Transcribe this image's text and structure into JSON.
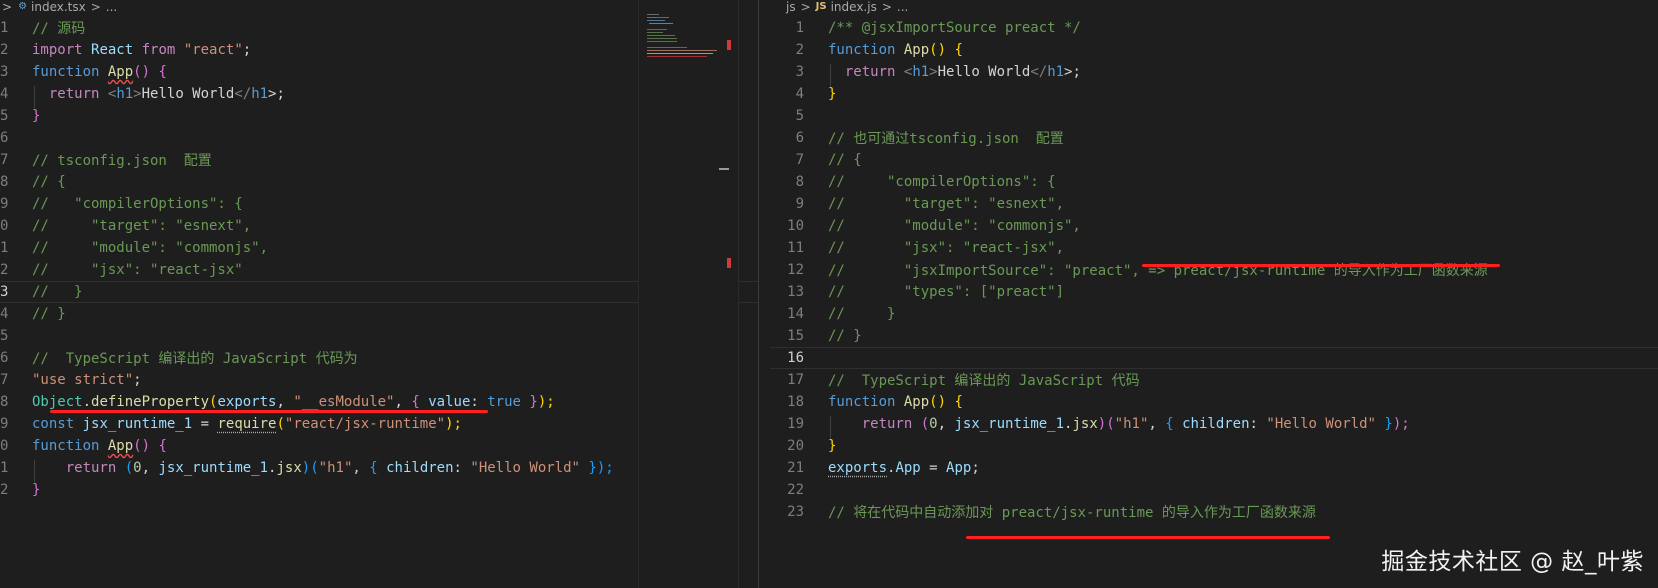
{
  "left_editor": {
    "breadcrumb": {
      "prefix": ">",
      "filename": "index.tsx",
      "sep": ">",
      "ellipsis": "..."
    },
    "lines": [
      "1",
      "2",
      "3",
      "4",
      "5",
      "6",
      "7",
      "8",
      "9",
      "0",
      "1",
      "2",
      "3",
      "4",
      "5",
      "6",
      "7",
      "8",
      "9",
      "0",
      "1",
      "2"
    ],
    "current_line_index": 12
  },
  "right_editor": {
    "breadcrumb": {
      "folder": "js",
      "sep": ">",
      "icon": "JS",
      "filename": "index.js",
      "sep2": ">",
      "ellipsis": "..."
    },
    "lines": [
      "1",
      "2",
      "3",
      "4",
      "5",
      "6",
      "7",
      "8",
      "9",
      "10",
      "11",
      "12",
      "13",
      "14",
      "15",
      "16",
      "17",
      "18",
      "19",
      "20",
      "21",
      "22",
      "23"
    ],
    "current_line_index": 15
  },
  "colors": {
    "background": "#1e1e1e",
    "comment": "#6a9955",
    "keyword": "#569cd6",
    "string": "#ce9178",
    "function": "#dcdcaa",
    "highlight_underline": "#ff1f1f"
  },
  "watermark": "掘金技术社区 @ 赵_叶紫",
  "code": {
    "l1": "// 源码",
    "l2_import": "import",
    "l2_react": "React",
    "l2_from": "from",
    "l2_str": "\"react\"",
    "l2_semi": ";",
    "l3_function": "function",
    "l3_name": "App",
    "l3_paren": "()",
    "l3_brace": "{",
    "l4_return": "return",
    "l4_open": "<",
    "l4_tag": "h1",
    "l4_gt": ">",
    "l4_text": "Hello World",
    "l4_close": "</",
    "l4_tag2": "h1",
    "l4_end": ">;",
    "l5": "}",
    "l7": "// tsconfig.json  配置",
    "l8": "// {",
    "l9": "//   \"compilerOptions\": {",
    "l10": "//     \"target\": \"esnext\",",
    "l11": "//     \"module\": \"commonjs\",",
    "l12": "//     \"jsx\": \"react-jsx\"",
    "l13": "//   }",
    "l14": "// }",
    "l16": "//  TypeScript 编译出的 JavaScript 代码为",
    "l17_str": "\"use strict\"",
    "l17_semi": ";",
    "l18_obj": "Object",
    "l18_dot": ".",
    "l18_fn": "defineProperty",
    "l18_open": "(",
    "l18_exports": "exports",
    "l18_comma": ", ",
    "l18_str": "\"__esModule\"",
    "l18_comma2": ", ",
    "l18_ob": "{",
    "l18_value": " value",
    "l18_colon": ": ",
    "l18_true": "true",
    "l18_cb": " }",
    "l18_end": ");",
    "l19_const": "const",
    "l19_var": "jsx_runtime_1",
    "l19_eq": " = ",
    "l19_req": "require",
    "l19_open": "(",
    "l19_str": "\"react/jsx-runtime\"",
    "l19_end": ");",
    "l20_function": "function",
    "l20_name": "App",
    "l20_paren": "()",
    "l20_brace": "{",
    "l21_return": "return",
    "l21_open": "(",
    "l21_zero": "0",
    "l21_comma": ", ",
    "l21_var": "jsx_runtime_1",
    "l21_dot": ".",
    "l21_jsx": "jsx",
    "l21_close": ")",
    "l21_open2": "(",
    "l21_h1": "\"h1\"",
    "l21_comma2": ", ",
    "l21_ob": "{",
    "l21_children": " children",
    "l21_colon": ": ",
    "l21_hw": "\"Hello World\"",
    "l21_cb": " }",
    "l21_end": ");",
    "l22": "}",
    "r1": "/** @jsxImportSource preact */",
    "r2_function": "function",
    "r2_name": "App",
    "r2_paren": "()",
    "r2_brace": "{",
    "r3_return": "return",
    "r3_open": "<",
    "r3_tag": "h1",
    "r3_gt": ">",
    "r3_text": "Hello World",
    "r3_close": "</",
    "r3_tag2": "h1",
    "r3_end": ">;",
    "r4": "}",
    "r6": "// 也可通过tsconfig.json  配置",
    "r7": "// {",
    "r8": "//     \"compilerOptions\": {",
    "r9": "//       \"target\": \"esnext\",",
    "r10": "//       \"module\": \"commonjs\",",
    "r11": "//       \"jsx\": \"react-jsx\",",
    "r12": "//       \"jsxImportSource\": \"preact\", => preact/jsx-runtime 的导入作为工厂函数来源",
    "r13": "//       \"types\": [\"preact\"]",
    "r14": "//     }",
    "r15": "// }",
    "r17": "//  TypeScript 编译出的 JavaScript 代码",
    "r18_function": "function",
    "r18_name": "App",
    "r18_paren": "()",
    "r18_brace": "{",
    "r19_return": "return",
    "r19_open": "(",
    "r19_zero": "0",
    "r19_comma": ", ",
    "r19_var": "jsx_runtime_1",
    "r19_dot": ".",
    "r19_jsx": "jsx",
    "r19_close": ")",
    "r19_open2": "(",
    "r19_h1": "\"h1\"",
    "r19_comma2": ", ",
    "r19_ob": "{",
    "r19_children": " children",
    "r19_colon": ": ",
    "r19_hw": "\"Hello World\"",
    "r19_cb": " }",
    "r19_end": ");",
    "r20": "}",
    "r21_exports": "exports",
    "r21_dot": ".",
    "r21_app": "App",
    "r21_eq": " = ",
    "r21_app2": "App",
    "r21_semi": ";",
    "r23": "// 将在代码中自动添加对 preact/jsx-runtime 的导入作为工厂函数来源"
  }
}
